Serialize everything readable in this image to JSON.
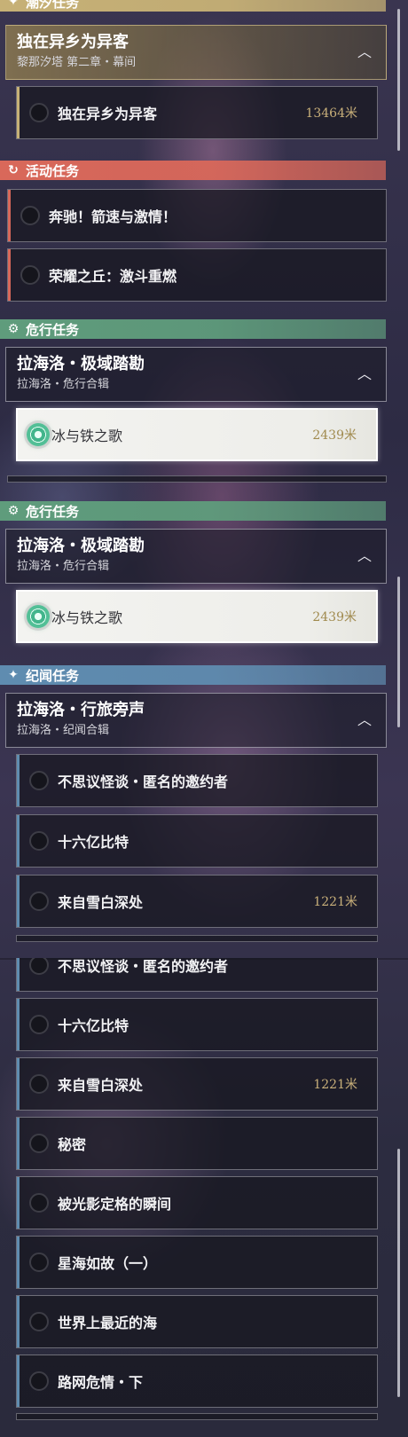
{
  "colors": {
    "main_accent": "#c7b176",
    "event_accent": "#d9685a",
    "peril_accent": "#5f9c7c",
    "story_accent": "#5f8cb0",
    "distance_gold": "#c9b07a"
  },
  "section1": {
    "main": {
      "category": "潮汐任务",
      "icon": "sparkle-icon",
      "group_title": "独在异乡为异客",
      "group_sub": "黎那汐塔 第二章・幕间",
      "quest": {
        "name": "独在异乡为异客",
        "distance": "13464米"
      }
    },
    "event": {
      "category": "活动任务",
      "icon": "event-refresh-icon",
      "quests": [
        "奔驰！箭速与激情！",
        "荣耀之丘：激斗重燃"
      ]
    },
    "peril": {
      "category": "危行任务",
      "icon": "peril-gear-icon",
      "group_title": "拉海洛・极域踏勘",
      "group_sub": "拉海洛・危行合辑",
      "quest": {
        "name": "冰与铁之歌",
        "distance": "2439米"
      }
    }
  },
  "section2": {
    "peril": {
      "category": "危行任务",
      "icon": "peril-gear-icon",
      "group_title": "拉海洛・极域踏勘",
      "group_sub": "拉海洛・危行合辑",
      "quest": {
        "name": "冰与铁之歌",
        "distance": "2439米"
      }
    },
    "story": {
      "category": "纪闻任务",
      "icon": "sparkle-icon",
      "group_title": "拉海洛・行旅旁声",
      "group_sub": "拉海洛・纪闻合辑",
      "quests": [
        {
          "name": "不思议怪谈・匿名的邀约者",
          "distance": ""
        },
        {
          "name": "十六亿比特",
          "distance": ""
        },
        {
          "name": "来自雪白深处",
          "distance": "1221米"
        }
      ]
    }
  },
  "section3": {
    "quests": [
      {
        "name": "不思议怪谈・匿名的邀约者",
        "distance": ""
      },
      {
        "name": "十六亿比特",
        "distance": ""
      },
      {
        "name": "来自雪白深处",
        "distance": "1221米"
      },
      {
        "name": "秘密",
        "distance": ""
      },
      {
        "name": "被光影定格的瞬间",
        "distance": ""
      },
      {
        "name": "星海如故（一）",
        "distance": ""
      },
      {
        "name": "世界上最近的海",
        "distance": ""
      },
      {
        "name": "路网危情・下",
        "distance": ""
      }
    ]
  }
}
